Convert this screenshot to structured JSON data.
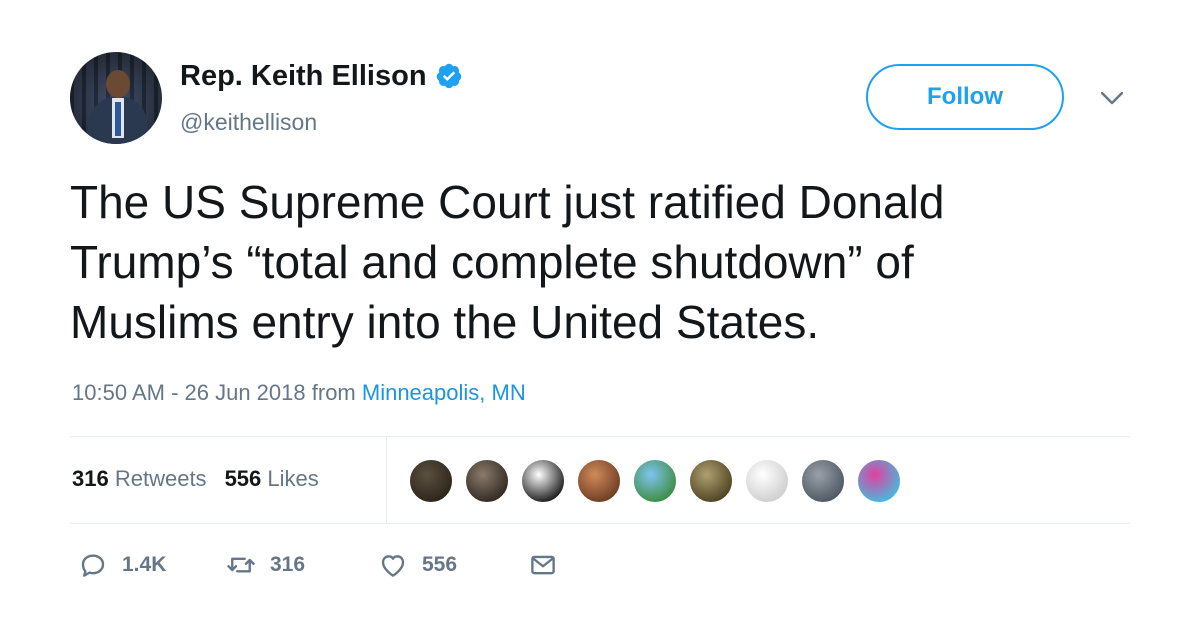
{
  "user": {
    "display_name": "Rep. Keith Ellison",
    "handle": "@keithellison",
    "verified": true
  },
  "follow_button": {
    "label": "Follow"
  },
  "tweet": {
    "text_lines": [
      "The US Supreme Court just ratified Donald",
      "Trump’s “total and complete shutdown” of",
      "Muslims entry into the United States."
    ],
    "time": "10:50 AM - 26 Jun 2018",
    "from_label": "from",
    "location": "Minneapolis, MN"
  },
  "stats": {
    "retweets_count": "316",
    "retweets_label": "Retweets",
    "likes_count": "556",
    "likes_label": "Likes"
  },
  "liker_avatars": [
    {
      "name": "liker-1",
      "colors": [
        "#5a5040",
        "#2a2418"
      ]
    },
    {
      "name": "liker-2",
      "colors": [
        "#8a7a6a",
        "#2e2620"
      ]
    },
    {
      "name": "liker-3",
      "colors": [
        "#ffffff",
        "#111111"
      ]
    },
    {
      "name": "liker-4",
      "colors": [
        "#d08a5a",
        "#6a3a20"
      ]
    },
    {
      "name": "liker-5",
      "colors": [
        "#7fc4f0",
        "#3a8a3a"
      ]
    },
    {
      "name": "liker-6",
      "colors": [
        "#b0a070",
        "#4a4020"
      ]
    },
    {
      "name": "liker-7",
      "colors": [
        "#ffffff",
        "#cccccc"
      ]
    },
    {
      "name": "liker-8",
      "colors": [
        "#9aa0a8",
        "#4a5560"
      ]
    },
    {
      "name": "liker-9",
      "colors": [
        "#e040a0",
        "#40c0e0"
      ]
    }
  ],
  "actions": {
    "reply_count": "1.4K",
    "retweet_count": "316",
    "like_count": "556"
  },
  "colors": {
    "accent": "#1da1f2",
    "link": "#1b95e0",
    "muted": "#657786",
    "text": "#14171a",
    "divider": "#e6ecf0"
  }
}
